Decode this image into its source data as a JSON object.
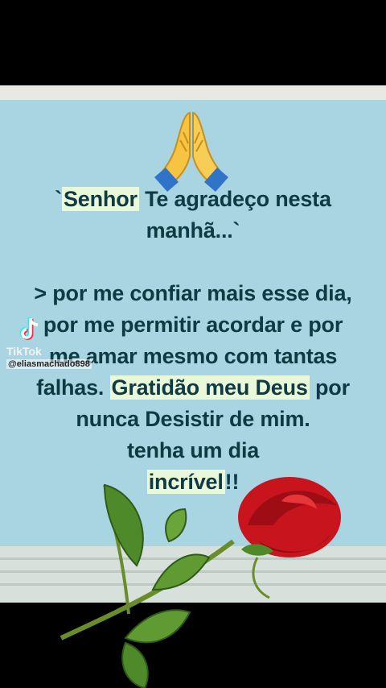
{
  "post": {
    "line1_prefix": "`",
    "line1_highlight": "Senhor",
    "line1_rest": " Te agradeço nesta",
    "line2": "manhã...`",
    "line3": "> por me confiar mais esse dia,",
    "line4": "por me permitir acordar e por",
    "line5": "me amar mesmo com tantas",
    "line6_prefix": "falhas. ",
    "line6_highlight": "Gratidão meu Deus",
    "line6_rest": " por",
    "line7": "nunca Desistir de mim.",
    "line8": "tenha um dia",
    "line9_highlight": "incrível",
    "line9_rest": "!!"
  },
  "watermark": {
    "brand": "TikTok",
    "username": "@eliasmachado898"
  },
  "icons": {
    "praying_hands": "praying-hands-icon",
    "tiktok_logo": "tiktok-logo-icon",
    "rose": "red-rose-illustration"
  },
  "colors": {
    "background": "#000000",
    "paper": "#a9d4e2",
    "text": "#0f3a43",
    "highlight": "#eaf8da",
    "rose": "#c8141c"
  }
}
